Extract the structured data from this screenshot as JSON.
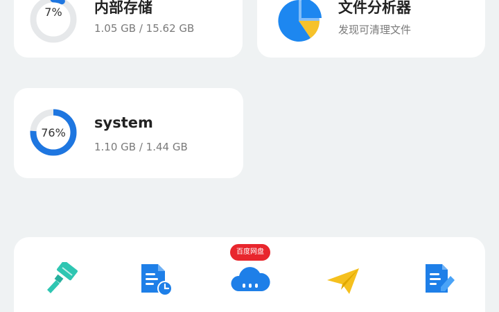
{
  "storage_cards": {
    "internal": {
      "title": "内部存储",
      "percent_label": "7%",
      "percent": 0.07,
      "usage": "1.05 GB / 15.62 GB"
    },
    "system": {
      "title": "system",
      "percent_label": "76%",
      "percent": 0.76,
      "usage": "1.10 GB / 1.44 GB"
    }
  },
  "analyzer_card": {
    "title": "文件分析器",
    "subtitle": "发现可清理文件",
    "icon": "pie-chart-icon"
  },
  "tools": {
    "items": [
      {
        "icon": "brush-clean-icon"
      },
      {
        "icon": "recent-file-icon"
      },
      {
        "icon": "cloud-disk-icon",
        "badge": "百度网盘"
      },
      {
        "icon": "send-plane-icon"
      },
      {
        "icon": "document-edit-icon"
      }
    ]
  },
  "colors": {
    "background": "#eff2f3",
    "card": "#ffffff",
    "ring_fill": "#1e76e0",
    "ring_track": "#e6e8ea",
    "pie_blue": "#1d87f0",
    "pie_yellow": "#f6c22b",
    "badge": "#e8262d",
    "brush": "#2fc6b2",
    "doc_blue": "#1e7fe8",
    "plane_yellow": "#f5c01e"
  }
}
